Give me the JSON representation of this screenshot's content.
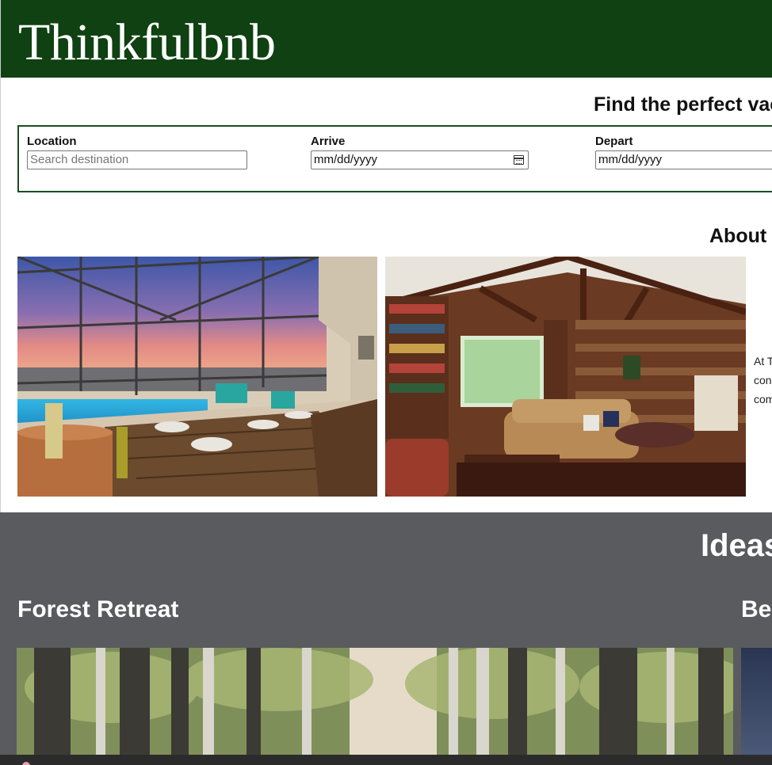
{
  "header": {
    "brand": "Thinkfulbnb"
  },
  "search": {
    "tagline": "Find the perfect vaca",
    "location": {
      "label": "Location",
      "placeholder": "Search destination"
    },
    "arrive": {
      "label": "Arrive",
      "value": "mm/dd/yyyy",
      "icon": "calendar-icon"
    },
    "depart": {
      "label": "Depart",
      "value": "mm/dd/yyyy"
    }
  },
  "about": {
    "title": "About",
    "text_lines": [
      "At T",
      "con",
      "com"
    ]
  },
  "ideas": {
    "title": "Ideas",
    "items": [
      {
        "name": "Forest Retreat"
      },
      {
        "name": "Bea"
      }
    ]
  },
  "colors": {
    "header_bg": "#0f4112",
    "form_border": "#1c4d22",
    "ideas_bg": "#5a5b5e"
  }
}
